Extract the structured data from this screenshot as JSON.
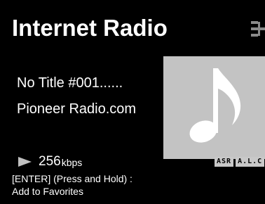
{
  "header": {
    "title": "Internet Radio",
    "network_icon": "network-icon"
  },
  "track": {
    "title": "No Title #001......",
    "station": "Pioneer Radio.com",
    "artwork_icon": "music-note-icon"
  },
  "status": {
    "play_icon": "play-icon",
    "bitrate_value": "256",
    "bitrate_unit": "kbps",
    "badges": [
      "ASR",
      "A.L.C"
    ]
  },
  "hint": {
    "line1": "[ENTER] (Press and Hold) :",
    "line2": "Add to Favorites"
  },
  "colors": {
    "background": "#000000",
    "text": "#ffffff",
    "artwork_bg": "#c3c3c3",
    "badge_bg": "#c8c8c8"
  }
}
